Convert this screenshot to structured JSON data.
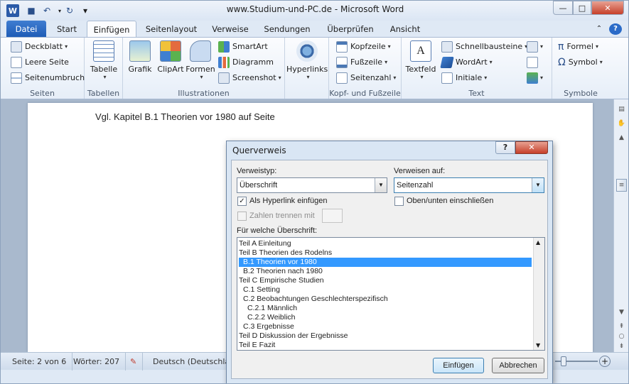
{
  "window": {
    "title": "www.Studium-und-PC.de - Microsoft Word",
    "min_glyph": "—",
    "max_glyph": "□",
    "close_glyph": "✕"
  },
  "quick_access": {
    "word_icon": "W",
    "save_icon": "■",
    "undo_icon": "↶",
    "redo_icon": "↻",
    "customize_icon": "▾"
  },
  "tabs": [
    {
      "label": "Datei"
    },
    {
      "label": "Start"
    },
    {
      "label": "Einfügen"
    },
    {
      "label": "Seitenlayout"
    },
    {
      "label": "Verweise"
    },
    {
      "label": "Sendungen"
    },
    {
      "label": "Überprüfen"
    },
    {
      "label": "Ansicht"
    }
  ],
  "ribbon": {
    "seiten": {
      "label": "Seiten",
      "deckblatt": "Deckblatt",
      "leere_seite": "Leere Seite",
      "seitenumbruch": "Seitenumbruch"
    },
    "tabellen": {
      "label": "Tabellen",
      "tabelle": "Tabelle"
    },
    "illustrationen": {
      "label": "Illustrationen",
      "grafik": "Grafik",
      "clipart": "ClipArt",
      "formen": "Formen",
      "smartart": "SmartArt",
      "diagramm": "Diagramm",
      "screenshot": "Screenshot"
    },
    "hyperlinks": {
      "label": "Hyperlinks"
    },
    "kopf": {
      "label": "Kopf- und Fußzeile",
      "kopfzeile": "Kopfzeile",
      "fusszeile": "Fußzeile",
      "seitenzahl": "Seitenzahl"
    },
    "text": {
      "label": "Text",
      "textfeld": "Textfeld",
      "schnellbausteine": "Schnellbausteine",
      "wordart": "WordArt",
      "initiale": "Initiale"
    },
    "symbole": {
      "label": "Symbole",
      "formel": "Formel",
      "symbol": "Symbol",
      "pi": "π",
      "omega": "Ω"
    }
  },
  "document": {
    "line": "Vgl. Kapitel B.1 Theorien vor 1980 auf Seite"
  },
  "status": {
    "page": "Seite: 2 von 6",
    "words": "Wörter: 207",
    "language": "Deutsch (Deutschland)"
  },
  "dialog": {
    "title": "Querverweis",
    "help": "?",
    "close": "✕",
    "verweistyp_label": "Verweistyp:",
    "verweistyp_value": "Überschrift",
    "verweisen_label": "Verweisen auf:",
    "verweisen_value": "Seitenzahl",
    "hyperlink_label": "Als Hyperlink einfügen",
    "hyperlink_checked": true,
    "oben_label": "Oben/unten einschließen",
    "zahlen_label": "Zahlen trennen mit",
    "list_label": "Für welche Überschrift:",
    "items": [
      {
        "text": "Teil A Einleitung",
        "indent": 0
      },
      {
        "text": "Teil B Theorien des Rodelns",
        "indent": 0
      },
      {
        "text": "B.1 Theorien vor 1980",
        "indent": 1,
        "selected": true
      },
      {
        "text": "B.2 Theorien nach 1980",
        "indent": 1
      },
      {
        "text": "Teil C Empirische Studien",
        "indent": 0
      },
      {
        "text": "C.1 Setting",
        "indent": 1
      },
      {
        "text": "C.2 Beobachtungen Geschlechterspezifisch",
        "indent": 1
      },
      {
        "text": "C.2.1 Männlich",
        "indent": 2
      },
      {
        "text": "C.2.2 Weiblich",
        "indent": 2
      },
      {
        "text": "C.3 Ergebnisse",
        "indent": 1
      },
      {
        "text": "Teil D Diskussion der Ergebnisse",
        "indent": 0
      },
      {
        "text": "Teil E Fazit",
        "indent": 0
      }
    ],
    "insert_button": "Einfügen",
    "cancel_button": "Abbrechen"
  }
}
